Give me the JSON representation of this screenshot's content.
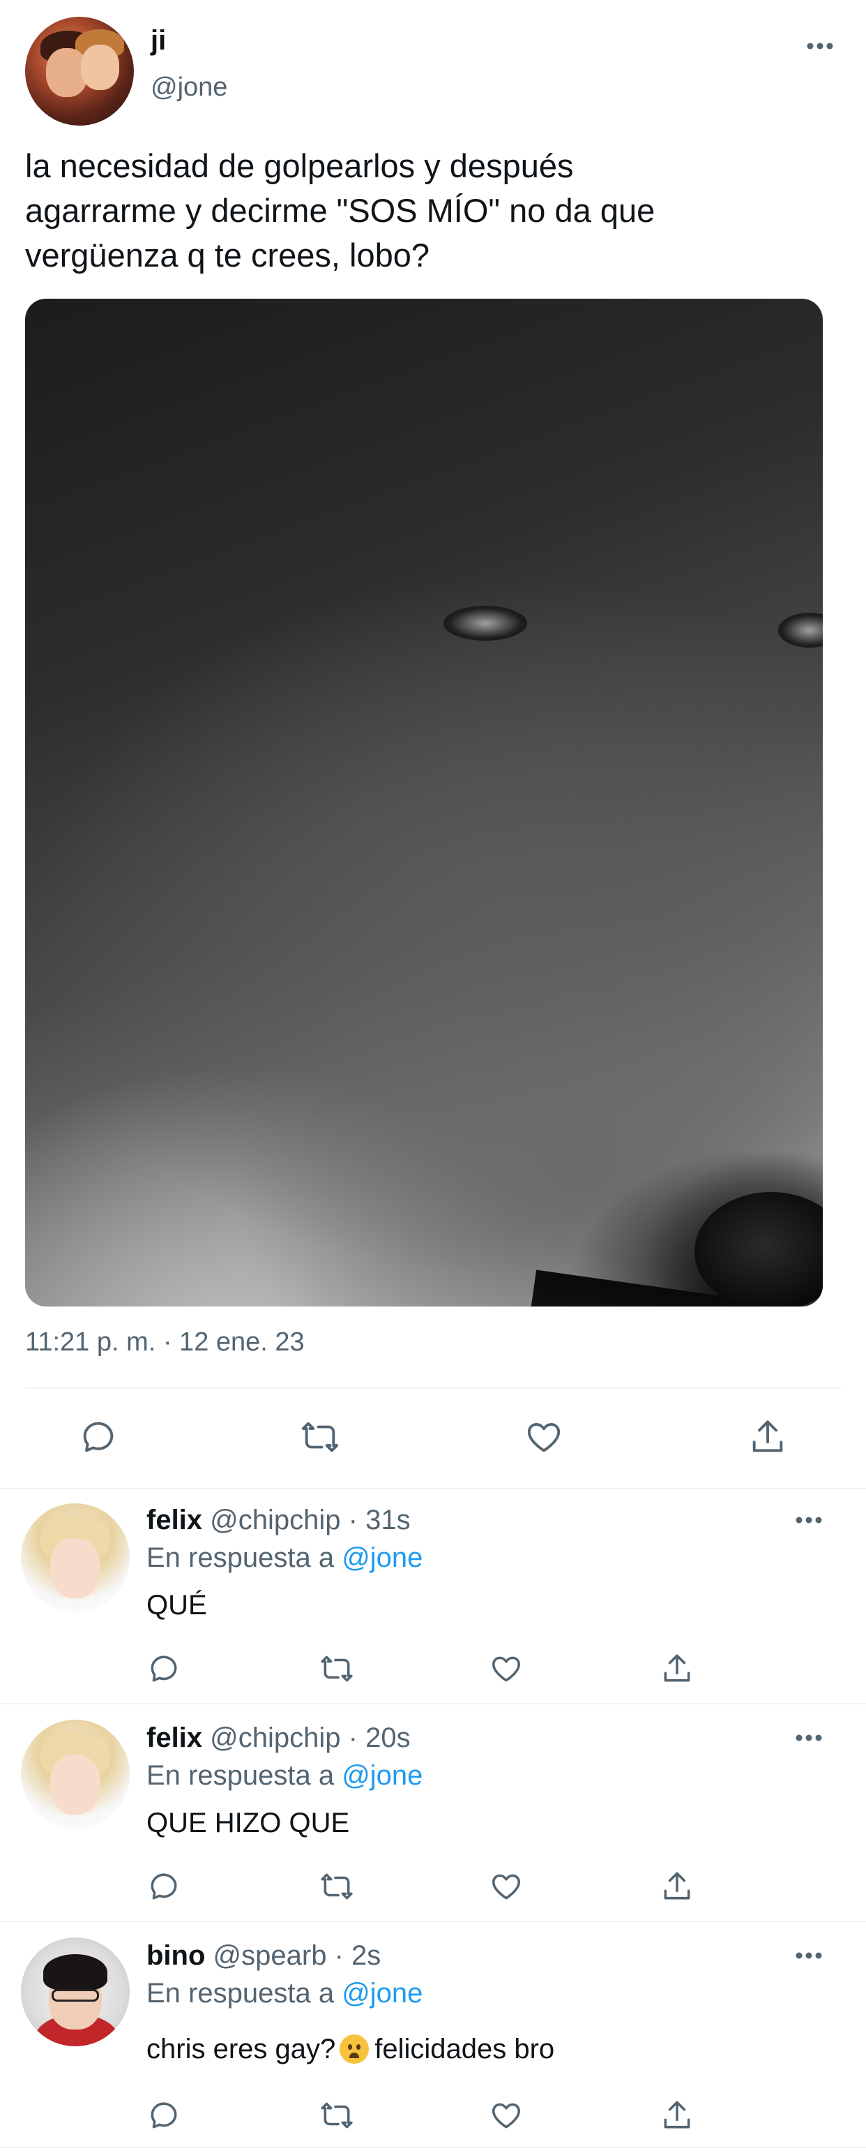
{
  "tweet": {
    "name": "ji",
    "handle": "@jone",
    "text": "la necesidad de golpearlos y después\nagarrarme y decirme \"SOS MÍO\" no da que\nvergüenza q te crees, lobo?",
    "timestamp": "11:21 p. m. · 12 ene. 23",
    "image_subject": "wolf",
    "actions": [
      "reply-icon",
      "retweet-icon",
      "like-icon",
      "share-icon"
    ]
  },
  "replies": [
    {
      "name": "felix",
      "handle": "@chipchip",
      "time": "· 31s",
      "reply_prefix": "En respuesta a",
      "reply_to": "@jone",
      "text": "QUÉ",
      "avatar": "felix"
    },
    {
      "name": "felix",
      "handle": "@chipchip",
      "time": "· 20s",
      "reply_prefix": "En respuesta a",
      "reply_to": "@jone",
      "text": "QUE HIZO QUE",
      "avatar": "felix"
    },
    {
      "name": "bino",
      "handle": "@spearb",
      "time": "· 2s",
      "reply_prefix": "En respuesta a",
      "reply_to": "@jone",
      "text_before_emoji": "chris eres gay?",
      "emoji": "frowning-face",
      "text_after_emoji": "felicidades bro",
      "avatar": "bino"
    }
  ],
  "colors": {
    "text": "#0f1419",
    "secondary": "#536471",
    "link": "#1d9bf0",
    "divider": "#eff3f4"
  }
}
